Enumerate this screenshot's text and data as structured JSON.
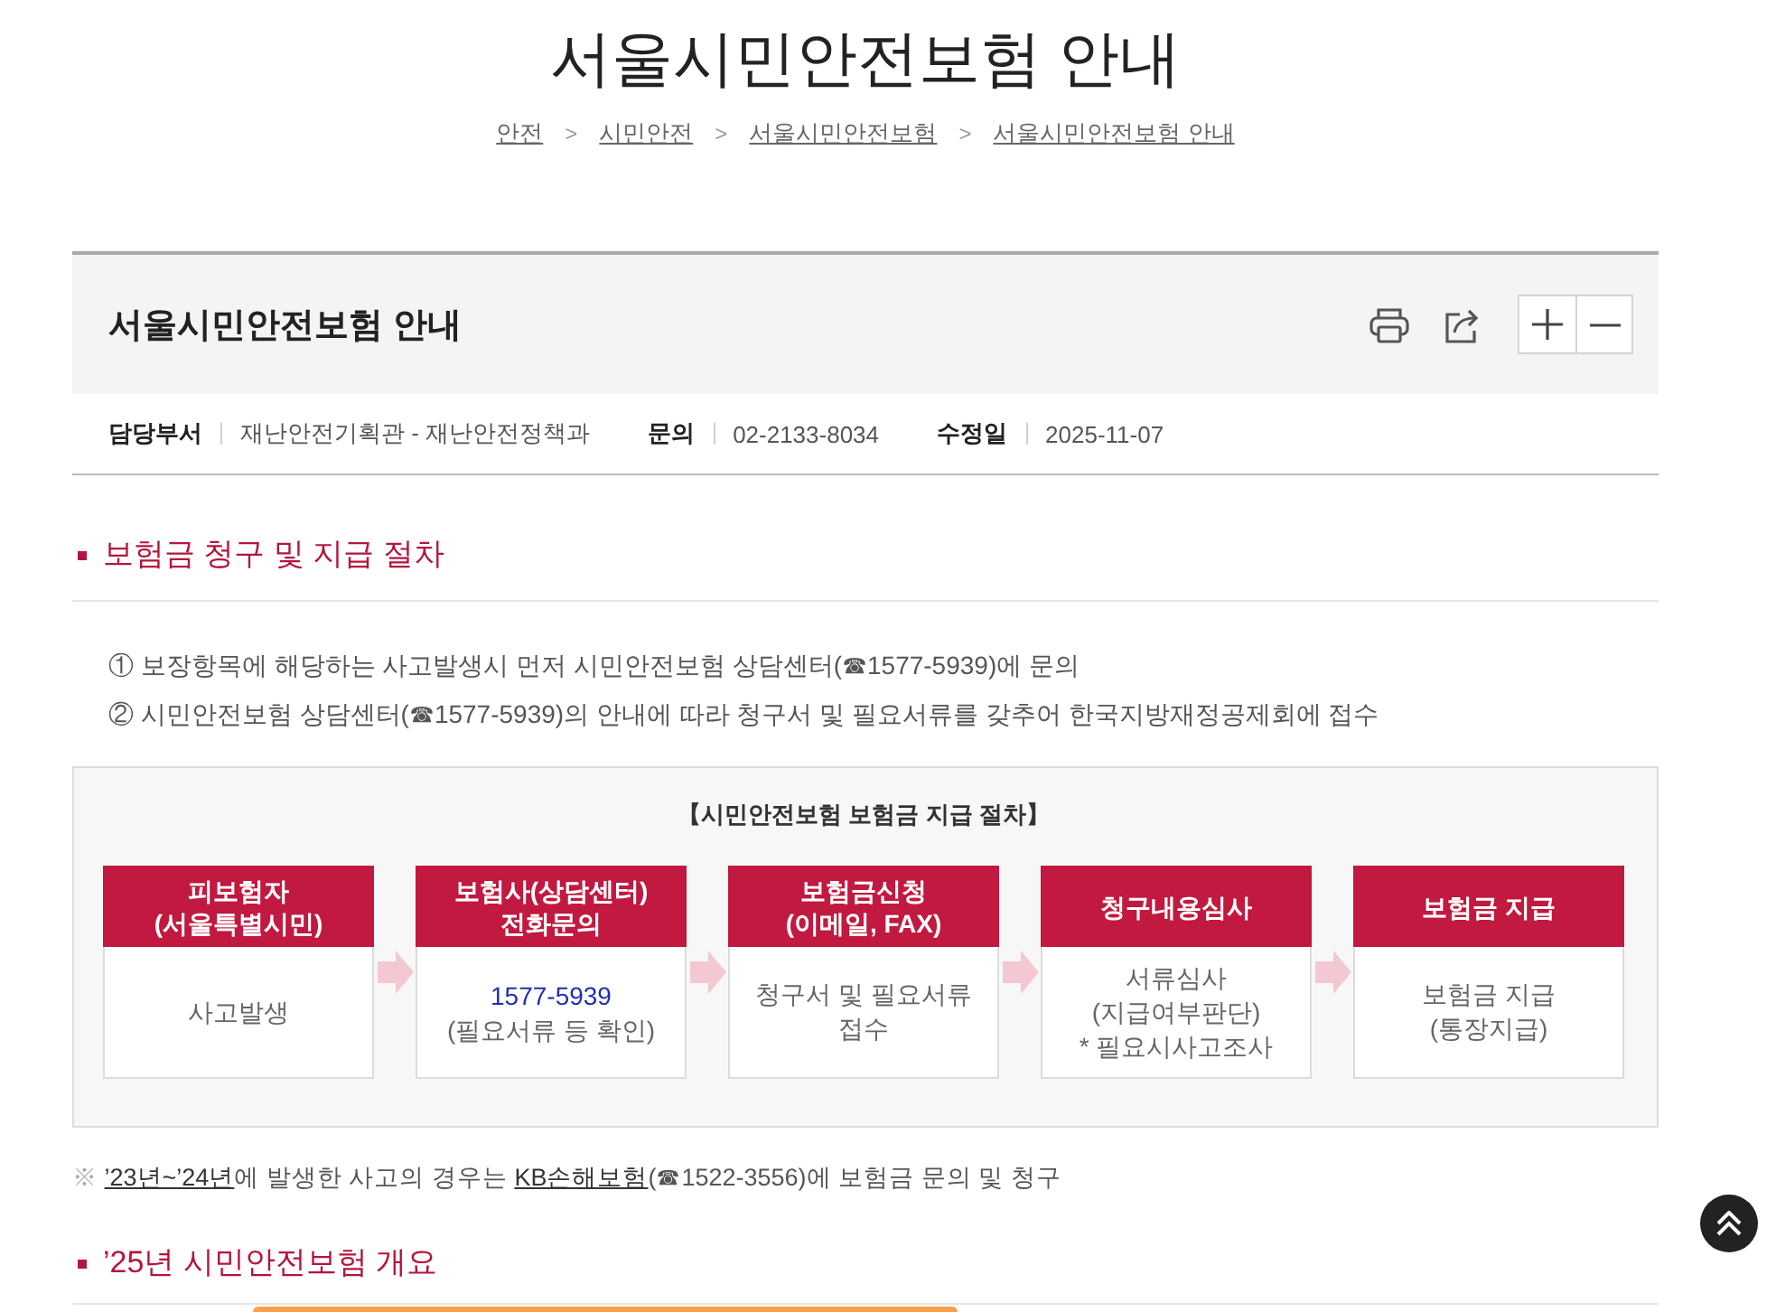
{
  "page_title": "서울시민안전보험 안내",
  "breadcrumb": [
    {
      "label": "안전"
    },
    {
      "prefix": ">",
      "label": "시민안전"
    },
    {
      "prefix": ">",
      "label": "서울시민안전보험"
    },
    {
      "prefix": ">",
      "label": "서울시민안전보험 안내"
    }
  ],
  "article": {
    "title": "서울시민안전보험 안내",
    "meta": [
      {
        "label": "담당부서",
        "value": "재난안전기획관 - 재난안전정책과"
      },
      {
        "label": "문의",
        "value": "02-2133-8034"
      },
      {
        "label": "수정일",
        "value": "2025-11-07"
      }
    ]
  },
  "sections": [
    {
      "heading": "보험금 청구 및 지급 절차",
      "list": [
        "① 보장항목에 해당하는 사고발생시 먼저 시민안전보험 상담센터(☎1577-5939)에 문의",
        "② 시민안전보험 상담센터(☎1577-5939)의 안내에 따라 청구서 및 필요서류를 갖추어 한국지방재정공제회에 접수"
      ],
      "diagram": {
        "title": "【시민안전보험 보험금 지급 절차】",
        "steps": [
          {
            "header": [
              "피보험자",
              "(서울특별시민)"
            ],
            "body": [
              {
                "kind": "text",
                "lines": [
                  "사고발생"
                ]
              }
            ]
          },
          {
            "header": [
              "보험사(상담센터)",
              "전화문의"
            ],
            "body": [
              {
                "kind": "phone",
                "lines": [
                  "1577-5939"
                ]
              },
              {
                "kind": "text",
                "lines": [
                  "(필요서류 등 확인)"
                ]
              }
            ]
          },
          {
            "header": [
              "보험금신청",
              "(이메일, FAX)"
            ],
            "body": [
              {
                "kind": "text",
                "lines": [
                  "청구서 및 필요서류",
                  "접수"
                ]
              }
            ]
          },
          {
            "header": [
              "청구내용심사"
            ],
            "body": [
              {
                "kind": "text",
                "lines": [
                  "서류심사",
                  "(지급여부판단)",
                  "* 필요시사고조사"
                ]
              }
            ]
          },
          {
            "header": [
              "보험금 지급"
            ],
            "body": [
              {
                "kind": "text",
                "lines": [
                  "보험금 지급",
                  "(통장지급)"
                ]
              }
            ]
          }
        ]
      },
      "note": [
        {
          "kind": "mark",
          "text": "※ "
        },
        {
          "kind": "link",
          "text": "’23년~’24년"
        },
        {
          "kind": "plain",
          "text": "에 발생한 사고의 경우는 "
        },
        {
          "kind": "link",
          "text": "KB손해보험"
        },
        {
          "kind": "plain",
          "text": "(☎1522-3556)에 보험금 문의 및 청구"
        }
      ]
    },
    {
      "heading": "’25년 시민안전보험 개요"
    }
  ]
}
